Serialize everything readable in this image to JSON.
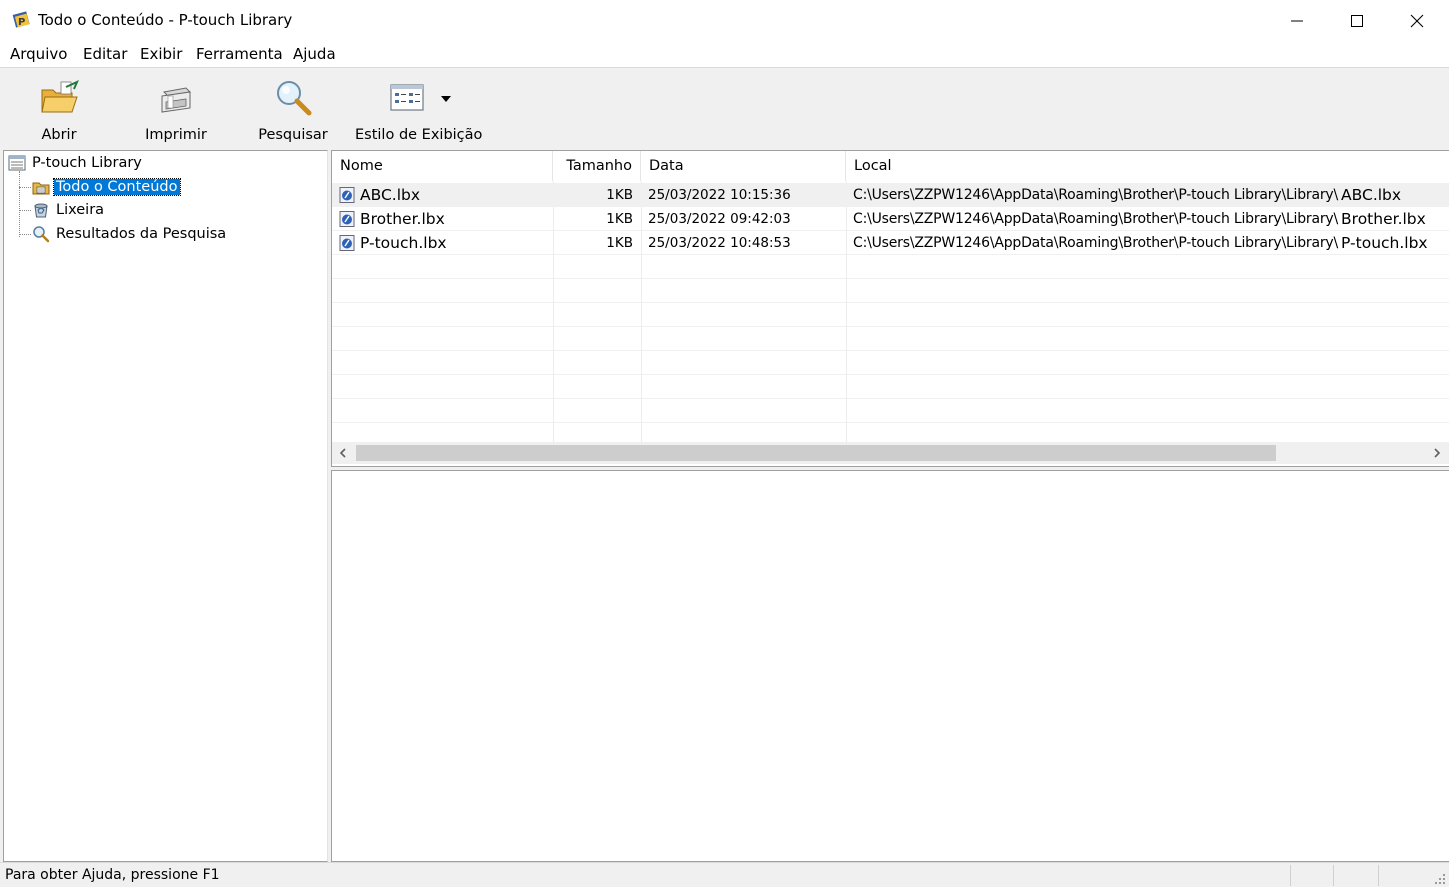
{
  "window": {
    "title": "Todo o Conteúdo - P-touch Library",
    "controls": [
      "minimize",
      "maximize",
      "close"
    ]
  },
  "menu": [
    {
      "label": "Arquivo"
    },
    {
      "label": "Editar"
    },
    {
      "label": "Exibir"
    },
    {
      "label": "Ferramenta"
    },
    {
      "label": "Ajuda"
    }
  ],
  "toolbar": {
    "open": {
      "label": "Abrir",
      "icon": "open-folder-icon"
    },
    "print": {
      "label": "Imprimir",
      "icon": "printer-icon"
    },
    "search": {
      "label": "Pesquisar",
      "icon": "magnifier-icon"
    },
    "view_style": {
      "label": "Estilo de Exibição",
      "icon": "view-style-icon"
    }
  },
  "tree": {
    "root": {
      "label": "P-touch Library",
      "icon": "library-icon"
    },
    "children": [
      {
        "label": "Todo o Conteúdo",
        "icon": "all-contents-icon",
        "selected": true
      },
      {
        "label": "Lixeira",
        "icon": "recycle-bin-icon",
        "selected": false
      },
      {
        "label": "Resultados da Pesquisa",
        "icon": "search-results-icon",
        "selected": false
      }
    ]
  },
  "list": {
    "columns": {
      "name": "Nome",
      "size": "Tamanho",
      "date": "Data",
      "location": "Local"
    },
    "rows": [
      {
        "name": "ABC.lbx",
        "size": "1KB",
        "date": "25/03/2022 10:15:36",
        "location": "C:\\Users\\ZZPW1246\\AppData\\Roaming\\Brother\\P-touch Library\\Library\\",
        "location_file": "ABC.lbx"
      },
      {
        "name": "Brother.lbx",
        "size": "1KB",
        "date": "25/03/2022 09:42:03",
        "location": "C:\\Users\\ZZPW1246\\AppData\\Roaming\\Brother\\P-touch Library\\Library\\",
        "location_file": "Brother.lbx"
      },
      {
        "name": "P-touch.lbx",
        "size": "1KB",
        "date": "25/03/2022 10:48:53",
        "location": "C:\\Users\\ZZPW1246\\AppData\\Roaming\\Brother\\P-touch Library\\Library\\",
        "location_file": "P-touch.lbx"
      }
    ]
  },
  "status": {
    "text": "Para obter Ajuda, pressione F1"
  },
  "colors": {
    "selection": "#0078d7",
    "chrome": "#f0f0f0",
    "border": "#a0a0a0"
  }
}
